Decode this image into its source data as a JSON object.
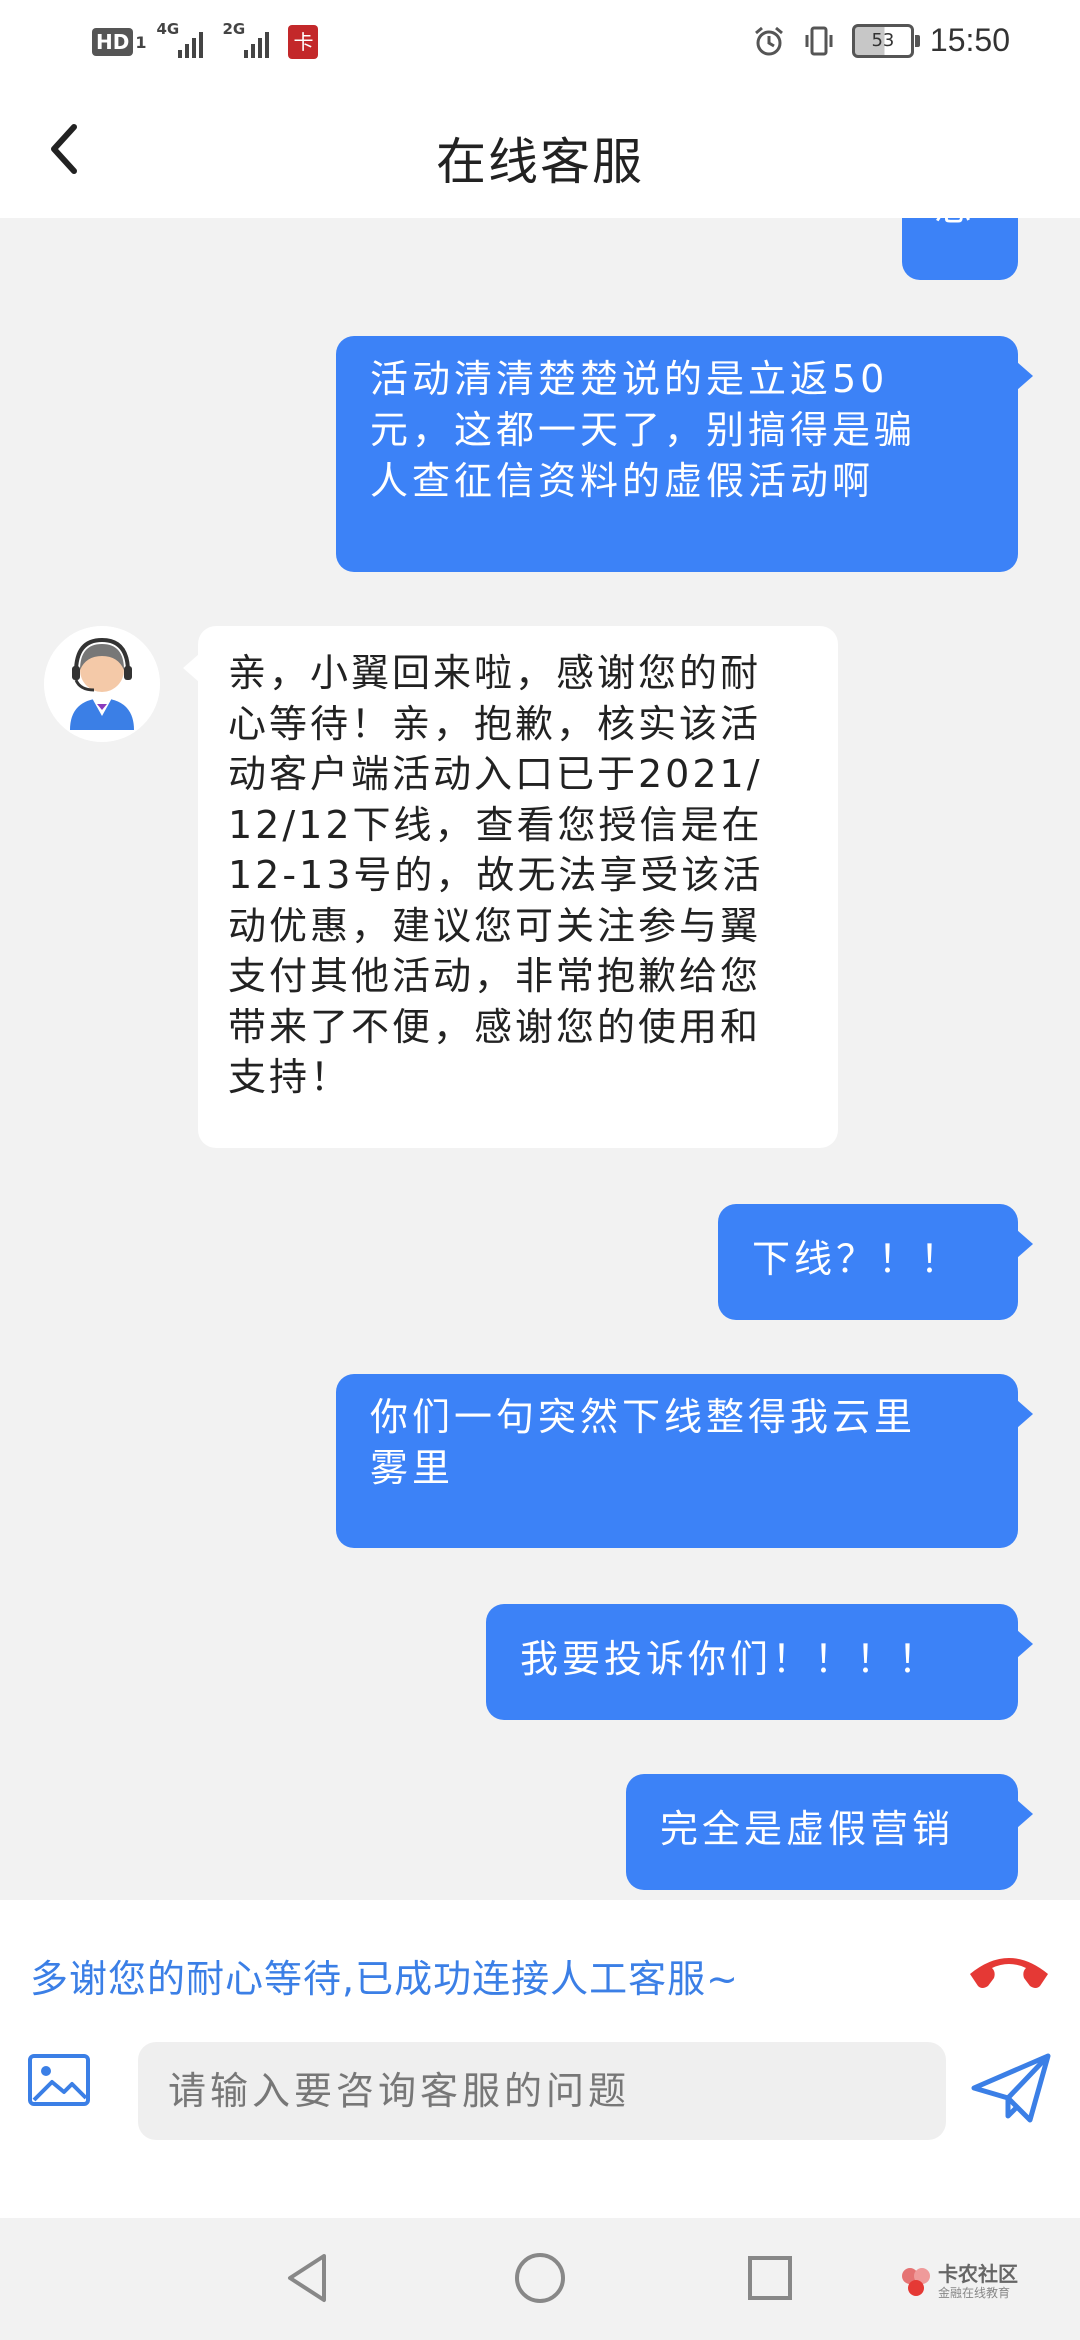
{
  "status_bar": {
    "hd": "HD",
    "hd_sub": "1",
    "net1": "4G",
    "net2": "2G",
    "app_notif_icon": "app-notification-icon",
    "battery": "53",
    "time": "15:50"
  },
  "header": {
    "title": "在线客服",
    "back_icon": "chevron-left-icon"
  },
  "messages": [
    {
      "from": "user",
      "text": "恩"
    },
    {
      "from": "user",
      "text": "活动清清楚楚说的是立返50\n元，这都一天了，别搞得是骗\n人查征信资料的虚假活动啊"
    },
    {
      "from": "agent",
      "text": "亲，小翼回来啦，感谢您的耐\n心等待！亲，抱歉，核实该活\n动客户端活动入口已于2021/\n12/12下线，查看您授信是在\n12-13号的，故无法享受该活\n动优惠，建议您可关注参与翼\n支付其他活动，非常抱歉给您\n带来了不便，感谢您的使用和\n支持！"
    },
    {
      "from": "user",
      "text": "下线？！！"
    },
    {
      "from": "user",
      "text": "你们一句突然下线整得我云里\n雾里"
    },
    {
      "from": "user",
      "text": "我要投诉你们！！！！"
    },
    {
      "from": "user",
      "text": "完全是虚假营销"
    }
  ],
  "bottom": {
    "notice": "多谢您的耐心等待,已成功连接人工客服~",
    "input_placeholder": "请输入要咨询客服的问题",
    "hangup_icon": "hangup-icon",
    "image_icon": "image-icon",
    "send_icon": "send-icon"
  },
  "watermark": {
    "title": "卡农社区",
    "subtitle": "金融在线教育"
  },
  "colors": {
    "bubble_out": "#3c82f7",
    "bubble_in": "#ffffff",
    "notice": "#3b7fe6",
    "hangup": "#e53935",
    "background": "#f2f2f2"
  }
}
